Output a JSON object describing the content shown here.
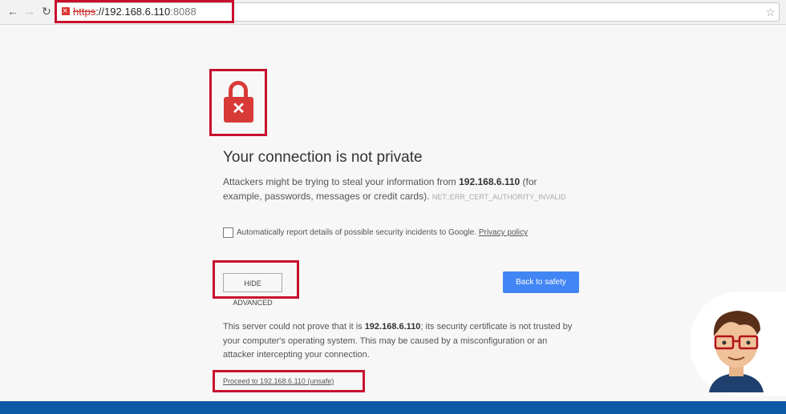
{
  "browser": {
    "url_scheme": "https",
    "url_sep": "://",
    "url_host": "192.168.6.110",
    "url_port": ":8088"
  },
  "page": {
    "title": "Your connection is not private",
    "desc_before": "Attackers might be trying to steal your information from ",
    "desc_host": "192.168.6.110",
    "desc_after": " (for example, passwords, messages or credit cards).",
    "error_code": "NET::ERR_CERT_AUTHORITY_INVALID",
    "report_label": "Automatically report details of possible security incidents to Google.",
    "privacy_link": "Privacy policy",
    "hide_advanced": "HIDE ADVANCED",
    "back_to_safety": "Back to safety",
    "details_before": "This server could not prove that it is ",
    "details_host": "192.168.6.110",
    "details_after": "; its security certificate is not trusted by your computer's operating system. This may be caused by a misconfiguration or an attacker intercepting your connection.",
    "proceed_link": "Proceed to 192.168.6.110 (unsafe)"
  },
  "colors": {
    "highlight": "#c8102e",
    "lock": "#d83a37",
    "primary_button": "#4285f4",
    "bottom_bar": "#0c5aa6"
  }
}
